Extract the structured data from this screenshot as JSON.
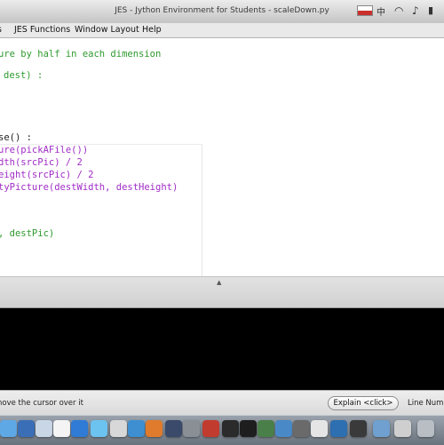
{
  "window": {
    "title": "JES - Jython Environment for Students - scaleDown.py"
  },
  "menu": {
    "items": [
      "s",
      "JES Functions",
      "Window Layout",
      "Help"
    ]
  },
  "editor": {
    "lines": [
      "ure by half in each dimension",
      "dest) :",
      "se() :",
      "ure(pickAFile())",
      "dth(srcPic) / 2",
      "eight(srcPic) / 2",
      "tyPicture(destWidth, destHeight)",
      ", destPic)"
    ]
  },
  "status": {
    "hint": "nove the cursor over it",
    "explain_label": "Explain <click>",
    "line_number_label": "Line Numb"
  },
  "icons": {
    "status": [
      "flag-icon",
      "cjk-icon",
      "wifi-icon",
      "volume-icon",
      "battery-icon"
    ],
    "dock": [
      "finder-icon",
      "dashboard-icon",
      "mail-icon",
      "safari-icon",
      "ical-icon",
      "itunes-icon",
      "firefox-icon",
      "chrome-icon",
      "system-preferences-icon",
      "app-icon",
      "app-icon",
      "terminal-icon",
      "app-icon",
      "app-icon",
      "app-icon",
      "app-icon",
      "trash-icon"
    ]
  },
  "colors": {
    "comment": "#2f9a2f",
    "function": "#a02cc6",
    "console_bg": "#000000"
  }
}
